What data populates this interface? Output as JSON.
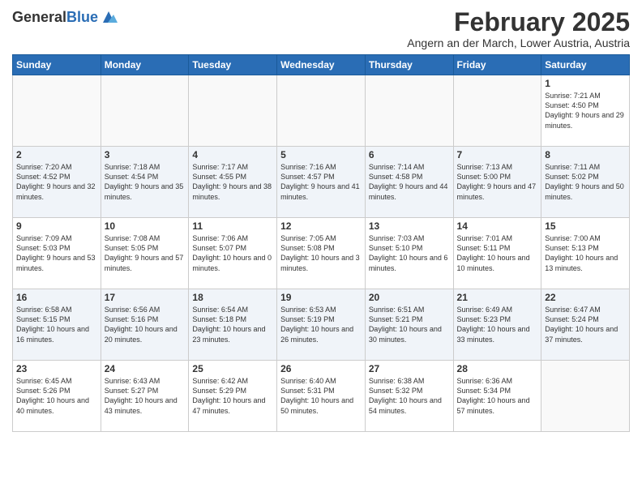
{
  "logo": {
    "general": "General",
    "blue": "Blue"
  },
  "title": "February 2025",
  "location": "Angern an der March, Lower Austria, Austria",
  "days_of_week": [
    "Sunday",
    "Monday",
    "Tuesday",
    "Wednesday",
    "Thursday",
    "Friday",
    "Saturday"
  ],
  "weeks": [
    [
      {
        "day": "",
        "empty": true
      },
      {
        "day": "",
        "empty": true
      },
      {
        "day": "",
        "empty": true
      },
      {
        "day": "",
        "empty": true
      },
      {
        "day": "",
        "empty": true
      },
      {
        "day": "",
        "empty": true
      },
      {
        "day": "1",
        "info": "Sunrise: 7:21 AM\nSunset: 4:50 PM\nDaylight: 9 hours and 29 minutes."
      }
    ],
    [
      {
        "day": "2",
        "info": "Sunrise: 7:20 AM\nSunset: 4:52 PM\nDaylight: 9 hours and 32 minutes."
      },
      {
        "day": "3",
        "info": "Sunrise: 7:18 AM\nSunset: 4:54 PM\nDaylight: 9 hours and 35 minutes."
      },
      {
        "day": "4",
        "info": "Sunrise: 7:17 AM\nSunset: 4:55 PM\nDaylight: 9 hours and 38 minutes."
      },
      {
        "day": "5",
        "info": "Sunrise: 7:16 AM\nSunset: 4:57 PM\nDaylight: 9 hours and 41 minutes."
      },
      {
        "day": "6",
        "info": "Sunrise: 7:14 AM\nSunset: 4:58 PM\nDaylight: 9 hours and 44 minutes."
      },
      {
        "day": "7",
        "info": "Sunrise: 7:13 AM\nSunset: 5:00 PM\nDaylight: 9 hours and 47 minutes."
      },
      {
        "day": "8",
        "info": "Sunrise: 7:11 AM\nSunset: 5:02 PM\nDaylight: 9 hours and 50 minutes."
      }
    ],
    [
      {
        "day": "9",
        "info": "Sunrise: 7:09 AM\nSunset: 5:03 PM\nDaylight: 9 hours and 53 minutes."
      },
      {
        "day": "10",
        "info": "Sunrise: 7:08 AM\nSunset: 5:05 PM\nDaylight: 9 hours and 57 minutes."
      },
      {
        "day": "11",
        "info": "Sunrise: 7:06 AM\nSunset: 5:07 PM\nDaylight: 10 hours and 0 minutes."
      },
      {
        "day": "12",
        "info": "Sunrise: 7:05 AM\nSunset: 5:08 PM\nDaylight: 10 hours and 3 minutes."
      },
      {
        "day": "13",
        "info": "Sunrise: 7:03 AM\nSunset: 5:10 PM\nDaylight: 10 hours and 6 minutes."
      },
      {
        "day": "14",
        "info": "Sunrise: 7:01 AM\nSunset: 5:11 PM\nDaylight: 10 hours and 10 minutes."
      },
      {
        "day": "15",
        "info": "Sunrise: 7:00 AM\nSunset: 5:13 PM\nDaylight: 10 hours and 13 minutes."
      }
    ],
    [
      {
        "day": "16",
        "info": "Sunrise: 6:58 AM\nSunset: 5:15 PM\nDaylight: 10 hours and 16 minutes."
      },
      {
        "day": "17",
        "info": "Sunrise: 6:56 AM\nSunset: 5:16 PM\nDaylight: 10 hours and 20 minutes."
      },
      {
        "day": "18",
        "info": "Sunrise: 6:54 AM\nSunset: 5:18 PM\nDaylight: 10 hours and 23 minutes."
      },
      {
        "day": "19",
        "info": "Sunrise: 6:53 AM\nSunset: 5:19 PM\nDaylight: 10 hours and 26 minutes."
      },
      {
        "day": "20",
        "info": "Sunrise: 6:51 AM\nSunset: 5:21 PM\nDaylight: 10 hours and 30 minutes."
      },
      {
        "day": "21",
        "info": "Sunrise: 6:49 AM\nSunset: 5:23 PM\nDaylight: 10 hours and 33 minutes."
      },
      {
        "day": "22",
        "info": "Sunrise: 6:47 AM\nSunset: 5:24 PM\nDaylight: 10 hours and 37 minutes."
      }
    ],
    [
      {
        "day": "23",
        "info": "Sunrise: 6:45 AM\nSunset: 5:26 PM\nDaylight: 10 hours and 40 minutes."
      },
      {
        "day": "24",
        "info": "Sunrise: 6:43 AM\nSunset: 5:27 PM\nDaylight: 10 hours and 43 minutes."
      },
      {
        "day": "25",
        "info": "Sunrise: 6:42 AM\nSunset: 5:29 PM\nDaylight: 10 hours and 47 minutes."
      },
      {
        "day": "26",
        "info": "Sunrise: 6:40 AM\nSunset: 5:31 PM\nDaylight: 10 hours and 50 minutes."
      },
      {
        "day": "27",
        "info": "Sunrise: 6:38 AM\nSunset: 5:32 PM\nDaylight: 10 hours and 54 minutes."
      },
      {
        "day": "28",
        "info": "Sunrise: 6:36 AM\nSunset: 5:34 PM\nDaylight: 10 hours and 57 minutes."
      },
      {
        "day": "",
        "empty": true
      }
    ]
  ]
}
